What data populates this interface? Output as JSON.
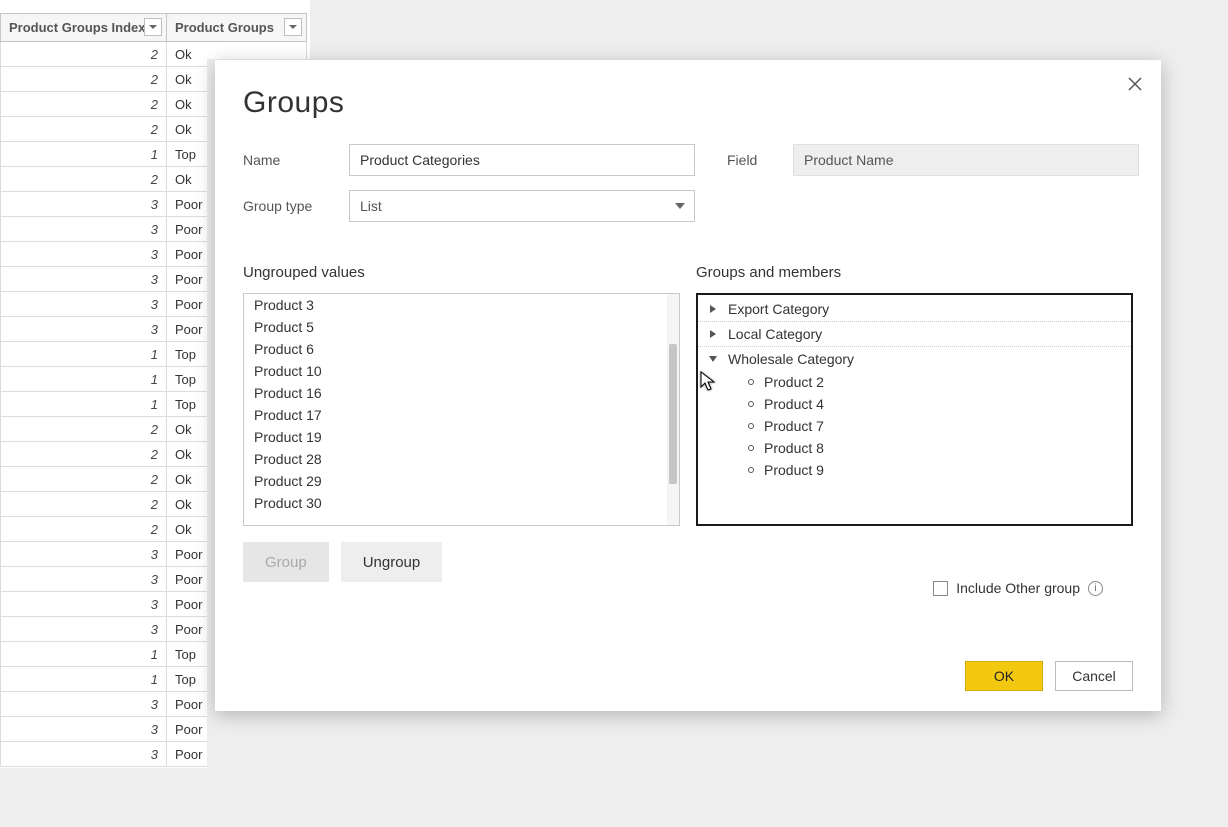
{
  "bg_table": {
    "col1": "Product Groups Index",
    "col2": "Product Groups",
    "rows": [
      {
        "idx": "2",
        "val": "Ok"
      },
      {
        "idx": "2",
        "val": "Ok"
      },
      {
        "idx": "2",
        "val": "Ok"
      },
      {
        "idx": "2",
        "val": "Ok"
      },
      {
        "idx": "1",
        "val": "Top"
      },
      {
        "idx": "2",
        "val": "Ok"
      },
      {
        "idx": "3",
        "val": "Poor"
      },
      {
        "idx": "3",
        "val": "Poor"
      },
      {
        "idx": "3",
        "val": "Poor"
      },
      {
        "idx": "3",
        "val": "Poor"
      },
      {
        "idx": "3",
        "val": "Poor"
      },
      {
        "idx": "3",
        "val": "Poor"
      },
      {
        "idx": "1",
        "val": "Top"
      },
      {
        "idx": "1",
        "val": "Top"
      },
      {
        "idx": "1",
        "val": "Top"
      },
      {
        "idx": "2",
        "val": "Ok"
      },
      {
        "idx": "2",
        "val": "Ok"
      },
      {
        "idx": "2",
        "val": "Ok"
      },
      {
        "idx": "2",
        "val": "Ok"
      },
      {
        "idx": "2",
        "val": "Ok"
      },
      {
        "idx": "3",
        "val": "Poor"
      },
      {
        "idx": "3",
        "val": "Poor"
      },
      {
        "idx": "3",
        "val": "Poor"
      },
      {
        "idx": "3",
        "val": "Poor"
      },
      {
        "idx": "1",
        "val": "Top"
      },
      {
        "idx": "1",
        "val": "Top"
      },
      {
        "idx": "3",
        "val": "Poor"
      },
      {
        "idx": "3",
        "val": "Poor"
      },
      {
        "idx": "3",
        "val": "Poor"
      }
    ]
  },
  "dialog": {
    "title": "Groups",
    "name_label": "Name",
    "name_value": "Product Categories",
    "field_label": "Field",
    "field_value": "Product Name",
    "group_type_label": "Group type",
    "group_type_value": "List",
    "ungrouped_title": "Ungrouped values",
    "ungrouped": [
      "Product 3",
      "Product 5",
      "Product 6",
      "Product 10",
      "Product 16",
      "Product 17",
      "Product 19",
      "Product 28",
      "Product 29",
      "Product 30"
    ],
    "groups_title": "Groups and members",
    "groups": [
      {
        "name": "Export Category",
        "expanded": false,
        "members": []
      },
      {
        "name": "Local Category",
        "expanded": false,
        "members": []
      },
      {
        "name": "Wholesale Category",
        "expanded": true,
        "members": [
          "Product 2",
          "Product 4",
          "Product 7",
          "Product 8",
          "Product 9"
        ]
      }
    ],
    "group_btn": "Group",
    "ungroup_btn": "Ungroup",
    "include_other": "Include Other group",
    "ok": "OK",
    "cancel": "Cancel"
  }
}
